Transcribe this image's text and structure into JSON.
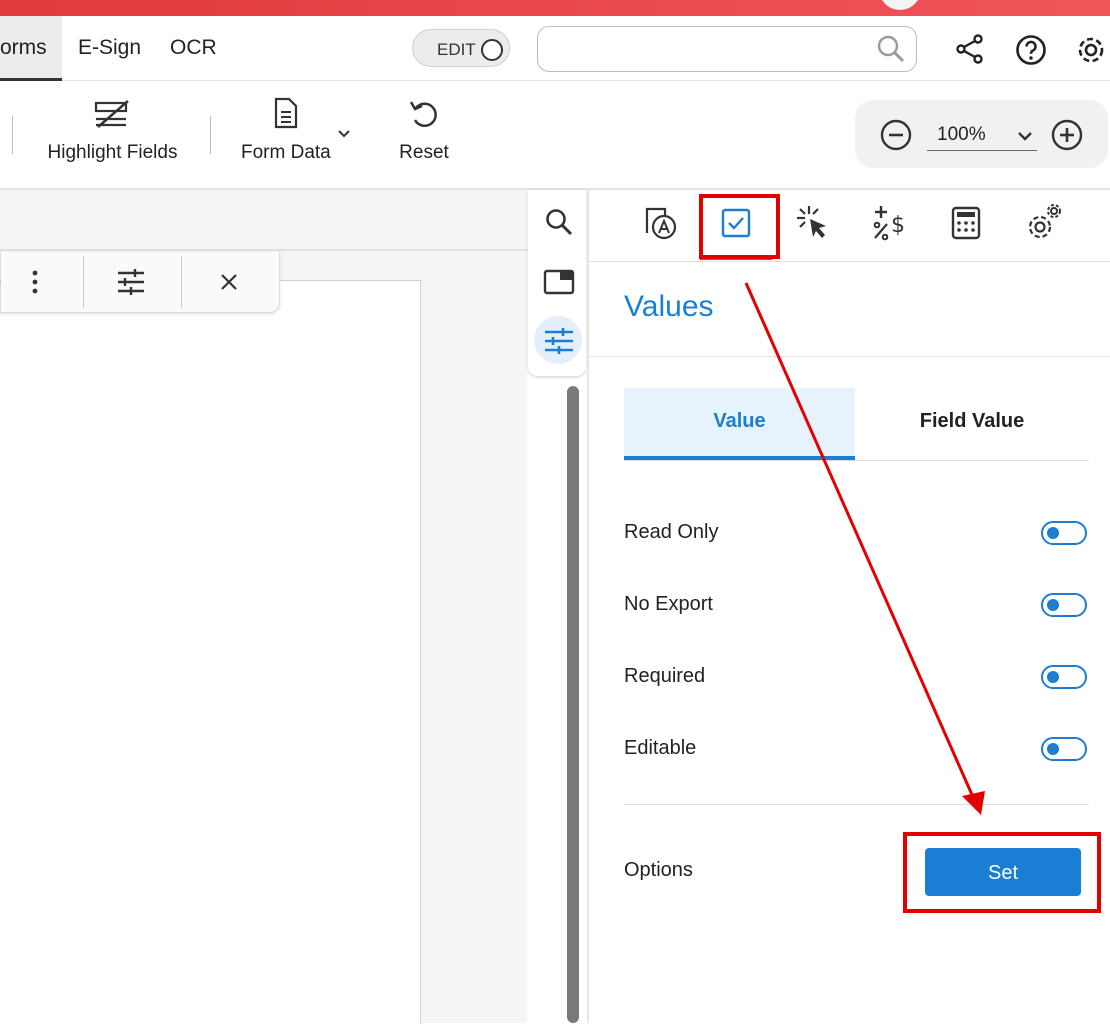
{
  "tabs": {
    "forms": "orms",
    "esign": "E-Sign",
    "ocr": "OCR"
  },
  "edit_toggle": {
    "label": "EDIT",
    "on": false
  },
  "search": {
    "value": "",
    "placeholder": ""
  },
  "toolbar": {
    "highlight_fields": "Highlight Fields",
    "form_data": "Form Data",
    "reset": "Reset"
  },
  "zoom": {
    "value": "100%"
  },
  "panel": {
    "title": "Values",
    "tabs": {
      "value": "Value",
      "field_value": "Field Value"
    },
    "active_tab": "Value",
    "toggles": [
      {
        "label": "Read Only",
        "on": true
      },
      {
        "label": "No Export",
        "on": true
      },
      {
        "label": "Required",
        "on": true
      },
      {
        "label": "Editable",
        "on": true
      }
    ],
    "options_label": "Options",
    "set_button": "Set"
  },
  "colors": {
    "accent": "#1a7fd4",
    "brand_red": "#e03a3e",
    "annotation_red": "#e30000"
  },
  "icons": {
    "top": [
      "search-icon",
      "share-icon",
      "help-icon",
      "gear-icon"
    ],
    "panel_tabs": [
      "field-text-icon",
      "checkbox-icon",
      "click-action-icon",
      "format-icon",
      "calculate-icon",
      "settings-icon"
    ],
    "rail": [
      "search-icon",
      "thumbnail-icon",
      "properties-icon"
    ]
  }
}
